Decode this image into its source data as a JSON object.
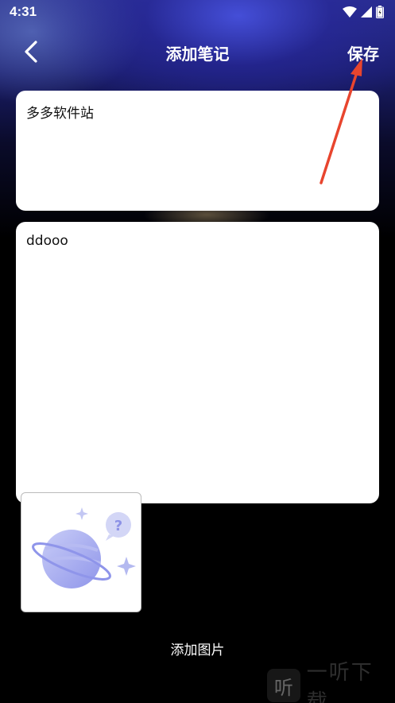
{
  "status_bar": {
    "time": "4:31"
  },
  "header": {
    "title": "添加笔记",
    "save_label": "保存"
  },
  "note": {
    "title_value": "多多软件站",
    "content_value": "ddooo"
  },
  "image_picker": {
    "label": "添加图片"
  },
  "watermark": {
    "logo_char": "听",
    "text": "一听下载"
  },
  "colors": {
    "accent_arrow": "#e8452e",
    "card_bg": "#ffffff",
    "page_bg": "#000000"
  }
}
